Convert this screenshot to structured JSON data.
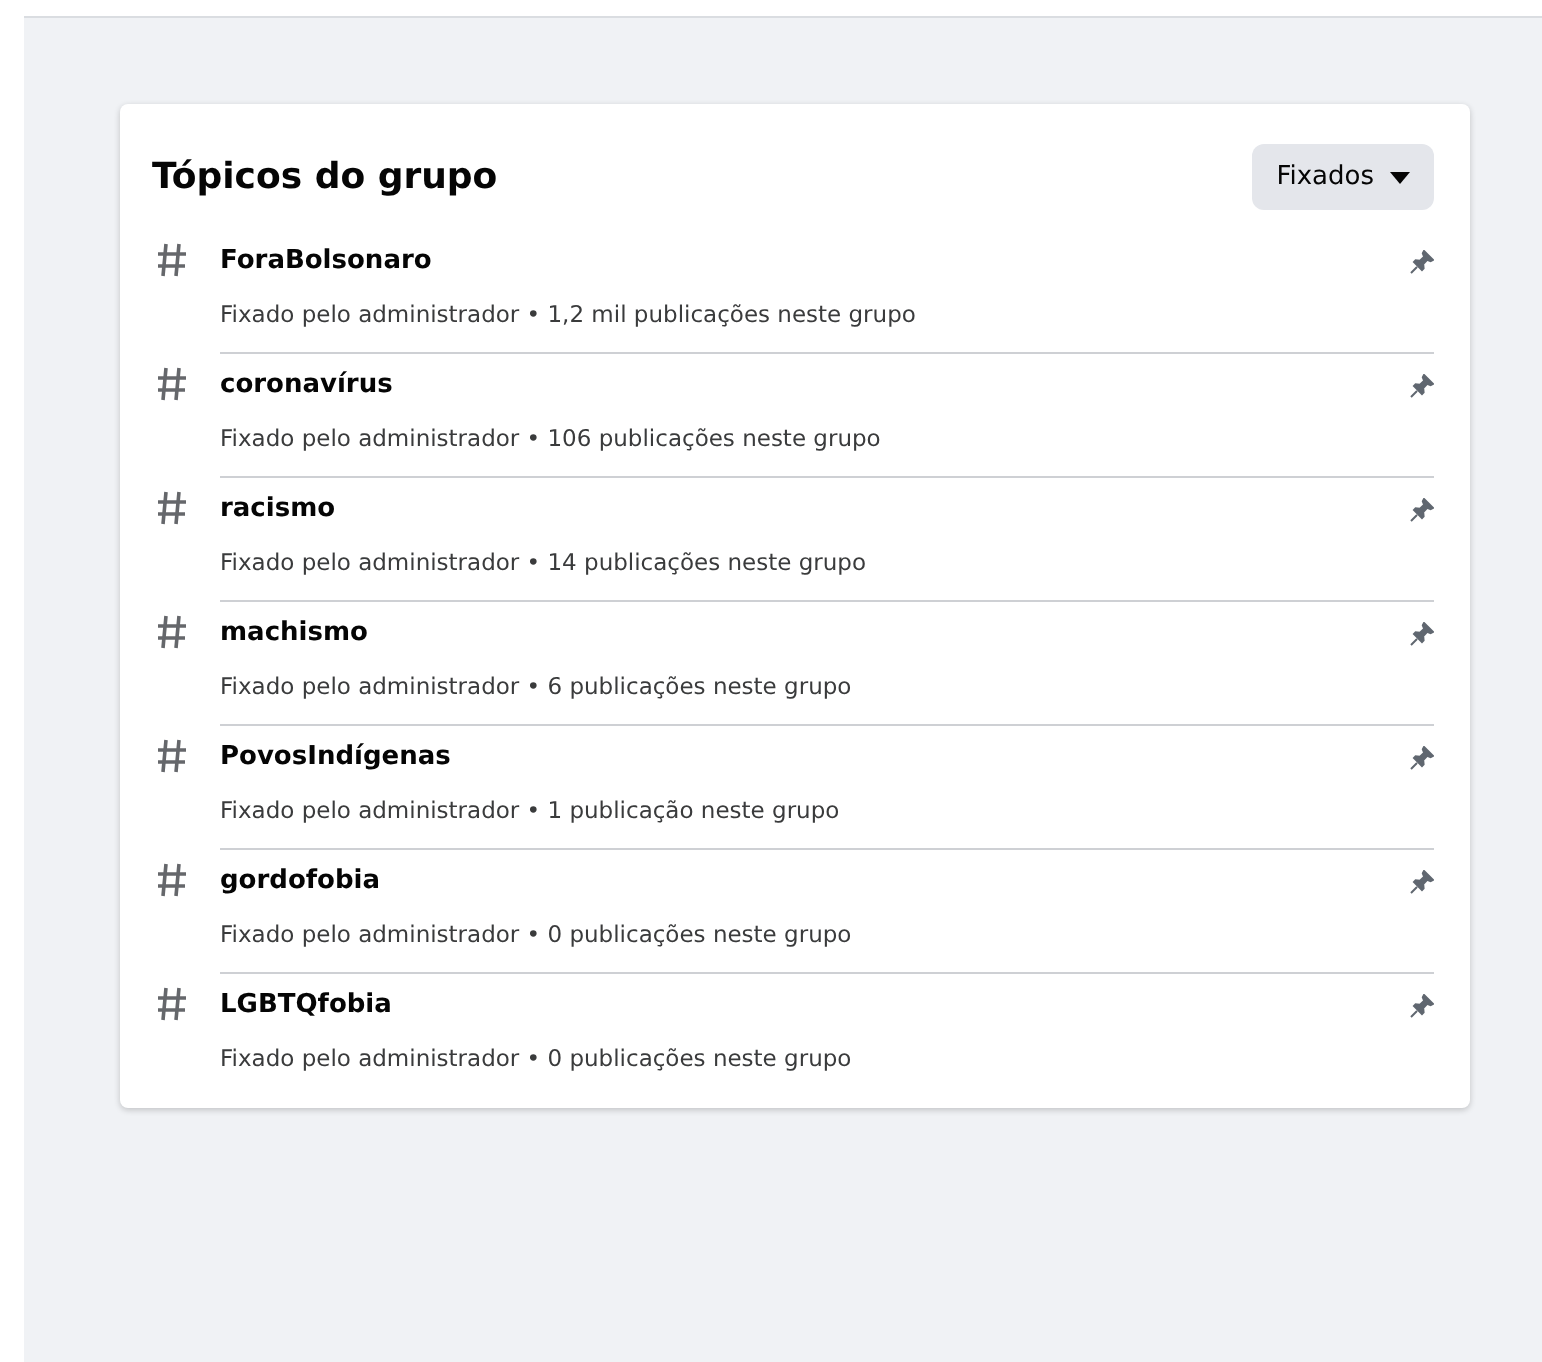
{
  "card": {
    "title": "Tópicos do grupo",
    "filter_button": {
      "label": "Fixados"
    }
  },
  "topics": [
    {
      "name": "ForaBolsonaro",
      "details": "Fixado pelo administrador • 1,2 mil publicações neste grupo"
    },
    {
      "name": "coronavírus",
      "details": "Fixado pelo administrador • 106 publicações neste grupo"
    },
    {
      "name": "racismo",
      "details": "Fixado pelo administrador • 14 publicações neste grupo"
    },
    {
      "name": "machismo",
      "details": "Fixado pelo administrador • 6 publicações neste grupo"
    },
    {
      "name": "PovosIndígenas",
      "details": "Fixado pelo administrador • 1 publicação neste grupo"
    },
    {
      "name": "gordofobia",
      "details": "Fixado pelo administrador • 0 publicações neste grupo"
    },
    {
      "name": "LGBTQfobia",
      "details": "Fixado pelo administrador • 0 publicações neste grupo"
    }
  ]
}
